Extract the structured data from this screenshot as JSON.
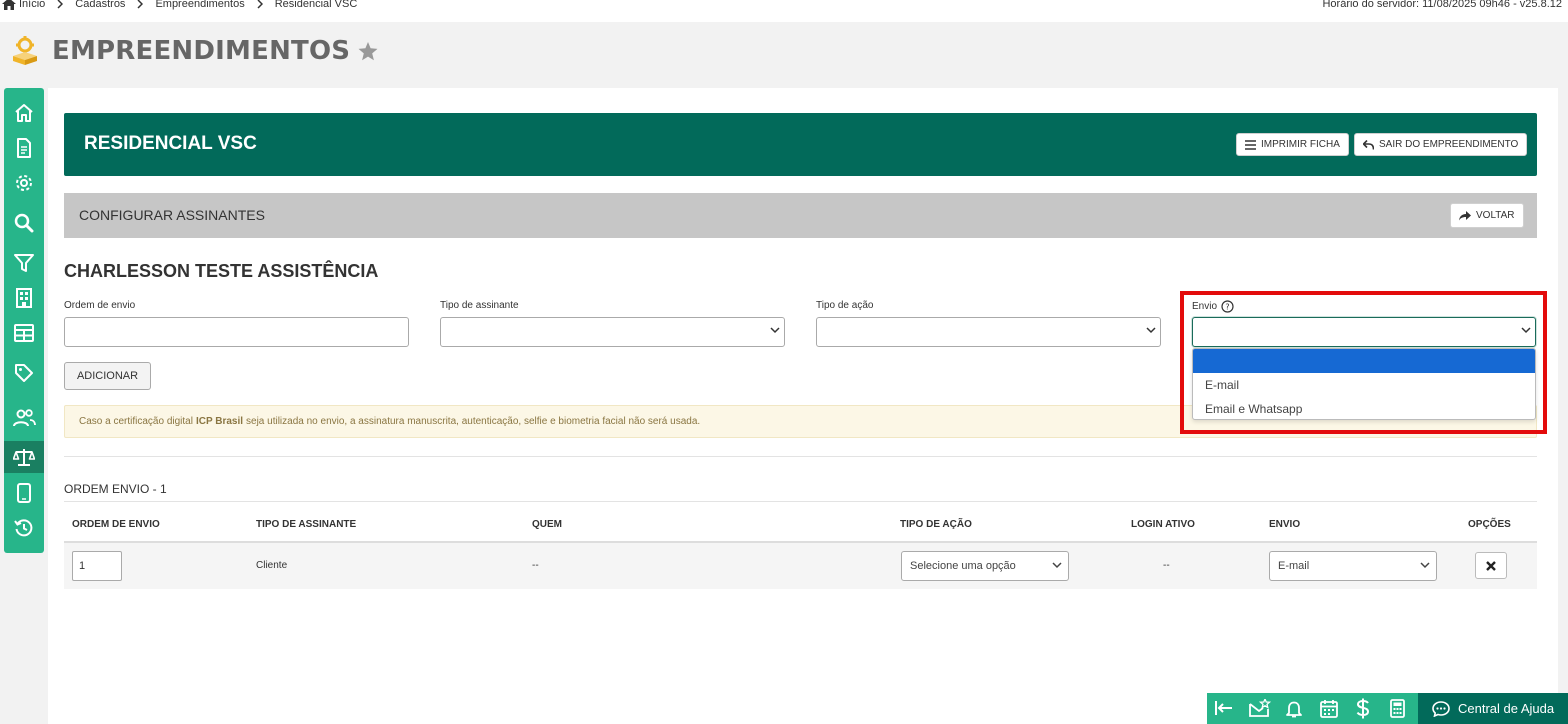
{
  "breadcrumb": [
    "Início",
    "Cadastros",
    "Empreendimentos",
    "Residencial VSC"
  ],
  "server_time": "Horário do servidor: 11/08/2025 09h46 - v25.8.12",
  "page": {
    "title": "EMPREENDIMENTOS"
  },
  "sidebar": {
    "items": [
      "home-icon",
      "document-icon",
      "gear-icon",
      "search-icon",
      "filter-icon",
      "building-icon",
      "table-icon",
      "tag-icon",
      "users-icon",
      "scale-icon",
      "mobile-icon",
      "history-icon"
    ],
    "active": "scale-icon"
  },
  "hero": {
    "title": "RESIDENCIAL VSC",
    "print_label": "IMPRIMIR FICHA",
    "exit_label": "SAIR DO EMPREENDIMENTO"
  },
  "section": {
    "title": "CONFIGURAR ASSINANTES",
    "back_label": "VOLTAR"
  },
  "signer": {
    "name": "CHARLESSON TESTE ASSISTÊNCIA"
  },
  "form": {
    "ordem_label": "Ordem de envio",
    "ordem_value": "",
    "tipo_assinante_label": "Tipo de assinante",
    "tipo_assinante_value": "",
    "tipo_acao_label": "Tipo de ação",
    "tipo_acao_value": "",
    "envio_label": "Envio",
    "envio_value": "",
    "envio_options": [
      "",
      "E-mail",
      "Email e Whatsapp"
    ],
    "add_label": "ADICIONAR"
  },
  "alert": {
    "pre": "Caso a certificação digital",
    "bold": "ICP Brasil",
    "post": "seja utilizada no envio, a assinatura manuscrita, autenticação, selfie e biometria facial não será usada."
  },
  "order_group": {
    "label": "ORDEM ENVIO - 1"
  },
  "table": {
    "headers": [
      "ORDEM DE ENVIO",
      "TIPO DE ASSINANTE",
      "QUEM",
      "TIPO DE AÇÃO",
      "LOGIN ATIVO",
      "ENVIO",
      "OPÇÕES"
    ],
    "rows": [
      {
        "ordem": "1",
        "tipo_assinante": "Cliente",
        "quem": "--",
        "tipo_acao": "Selecione uma opção",
        "login_ativo": "--",
        "envio": "E-mail"
      }
    ]
  },
  "bottom_bar": {
    "icons": [
      "collapse-icon",
      "mail-star-icon",
      "bell-icon",
      "calendar-icon",
      "dollar-icon",
      "calculator-icon"
    ],
    "help_label": "Central de Ajuda"
  },
  "colors": {
    "primary_dark": "#026a5a",
    "primary": "#27b58a",
    "highlight": "#e30b0b",
    "selected": "#1669d3"
  }
}
